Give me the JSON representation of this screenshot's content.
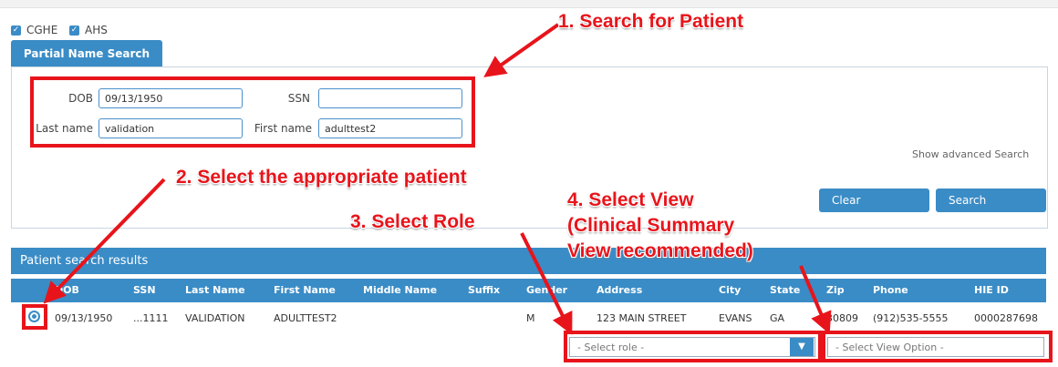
{
  "filters": [
    {
      "label": "CGHE",
      "checked": true
    },
    {
      "label": "AHS",
      "checked": true
    }
  ],
  "tab": {
    "label": "Partial Name Search"
  },
  "form": {
    "dob_label": "DOB",
    "dob_value": "09/13/1950",
    "ssn_label": "SSN",
    "ssn_value": "",
    "last_label": "Last name",
    "last_value": "validation",
    "first_label": "First name",
    "first_value": "adulttest2",
    "advanced_link": "Show advanced Search",
    "clear_button": "Clear",
    "search_button": "Search"
  },
  "results": {
    "title": "Patient search results",
    "columns": [
      "DOB",
      "SSN",
      "Last Name",
      "First Name",
      "Middle Name",
      "Suffix",
      "Gender",
      "Address",
      "City",
      "State",
      "Zip",
      "Phone",
      "HIE ID"
    ],
    "row": {
      "dob": "09/13/1950",
      "ssn": "...1111",
      "last": "VALIDATION",
      "first": "ADULTTEST2",
      "middle": "",
      "suffix": "",
      "gender": "M",
      "address": "123 MAIN STREET",
      "city": "EVANS",
      "state": "GA",
      "zip": "30809",
      "phone": "(912)535-5555",
      "hie": "0000287698"
    },
    "role_select": "- Select role -",
    "view_select": "- Select View Option -"
  },
  "annotations": {
    "step1": "1. Search for Patient",
    "step2": "2. Select the appropriate patient",
    "step3": "3. Select Role",
    "step4_line1": "4. Select View",
    "step4_line2": "(Clinical Summary",
    "step4_line3": "View recommended)"
  },
  "colors": {
    "primary": "#3a8cc6",
    "annotation": "#e8141b"
  },
  "icons": {
    "checkbox": "check-icon",
    "dropdown": "triangle-down-icon",
    "radio": "radio-selected-icon"
  }
}
